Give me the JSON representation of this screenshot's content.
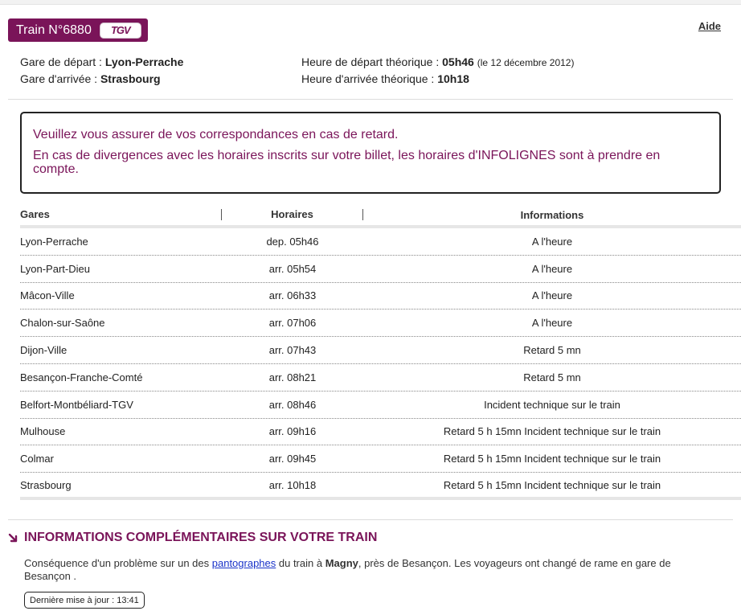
{
  "header": {
    "train_label": "Train N°6880",
    "tgv_logo": "TGV",
    "help_link": "Aide"
  },
  "journey": {
    "departure_station_label": "Gare de départ :",
    "departure_station": "Lyon-Perrache",
    "arrival_station_label": "Gare d'arrivée :",
    "arrival_station": "Strasbourg",
    "departure_time_label": "Heure de départ théorique :",
    "departure_time": "05h46",
    "departure_date": "(le 12 décembre 2012)",
    "arrival_time_label": "Heure d'arrivée théorique :",
    "arrival_time": "10h18"
  },
  "warning": {
    "line1": "Veuillez vous assurer de vos correspondances en cas de retard.",
    "line2": "En cas de divergences avec les horaires inscrits sur votre billet, les horaires d'INFOLIGNES sont à prendre en compte."
  },
  "table": {
    "headers": [
      "Gares",
      "Horaires",
      "Informations"
    ],
    "rows": [
      {
        "station": "Lyon-Perrache",
        "time": "dep. 05h46",
        "info": "A l'heure"
      },
      {
        "station": "Lyon-Part-Dieu",
        "time": "arr. 05h54",
        "info": "A l'heure"
      },
      {
        "station": "Mâcon-Ville",
        "time": "arr. 06h33",
        "info": "A l'heure"
      },
      {
        "station": "Chalon-sur-Saône",
        "time": "arr. 07h06",
        "info": "A l'heure"
      },
      {
        "station": "Dijon-Ville",
        "time": "arr. 07h43",
        "info": "Retard 5 mn"
      },
      {
        "station": "Besançon-Franche-Comté",
        "time": "arr. 08h21",
        "info": "Retard 5 mn"
      },
      {
        "station": "Belfort-Montbéliard-TGV",
        "time": "arr. 08h46",
        "info": "Incident technique sur le train"
      },
      {
        "station": "Mulhouse",
        "time": "arr. 09h16",
        "info": "Retard 5 h 15mn Incident technique sur le train"
      },
      {
        "station": "Colmar",
        "time": "arr. 09h45",
        "info": "Retard 5 h 15mn Incident technique sur le train"
      },
      {
        "station": "Strasbourg",
        "time": "arr. 10h18",
        "info": "Retard 5 h 15mn Incident technique sur le train"
      }
    ]
  },
  "extra": {
    "title": "INFORMATIONS COMPLÉMENTAIRES SUR VOTRE TRAIN",
    "text_before": "Conséquence d'un problème sur un des ",
    "link": "pantographes",
    "text_middle": " du train à ",
    "place": "Magny",
    "text_after": ", près de Besançon. Les voyageurs ont changé de rame en gare de Besançon .",
    "last_update": "Dernière mise à jour : 13:41"
  },
  "colors": {
    "brand": "#7a1459",
    "link": "#1a33c9"
  },
  "icons": {
    "section_arrow": "arrow-down-right-icon"
  }
}
